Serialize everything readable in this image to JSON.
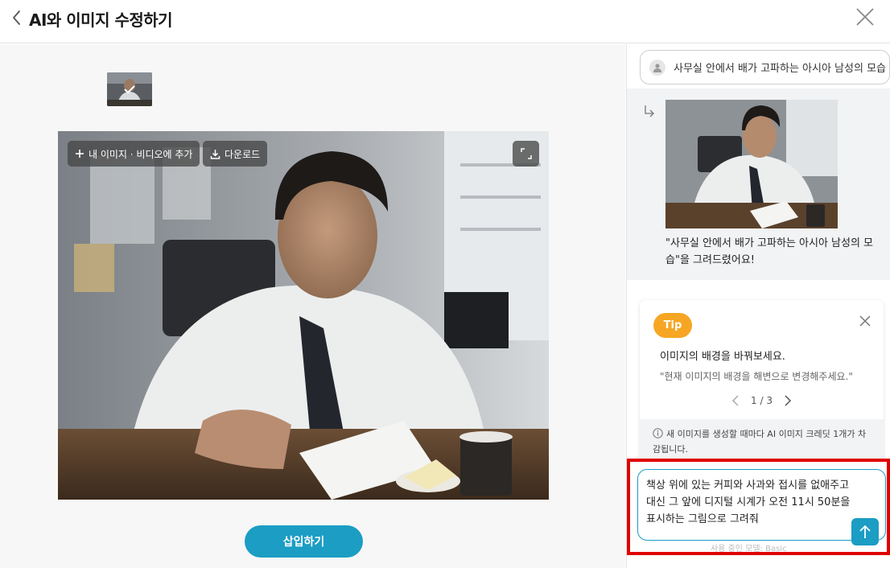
{
  "header": {
    "title": "AI와 이미지 수정하기"
  },
  "image_actions": {
    "add_label": "내 이미지 · 비디오에 추가",
    "download_label": "다운로드"
  },
  "insert_button": "삽입하기",
  "chat": {
    "prompt": "사무실 안에서 배가 고파하는 아시아 남성의 모습",
    "result_caption": "\"사무실 안에서 배가 고파하는 아시아 남성의 모습\"을 그려드렸어요!"
  },
  "tip": {
    "badge": "Tip",
    "title": "이미지의 배경을 바꿔보세요.",
    "example": "\"현재 이미지의 배경을 해변으로 변경해주세요.\"",
    "pager": "1 / 3",
    "notice": "새 이미지를 생성할 때마다 AI 이미지 크레딧 1개가 차감됩니다."
  },
  "input": {
    "value": "책상 위에 있는 커피와 사과와 접시를 없애주고 대신 그 앞에 디지털 시계가 오전 11시 50분을 표시하는 그림으로 그려줘",
    "model_note": "사용 중인 모델: Basic"
  },
  "colors": {
    "accent": "#1b9dc4",
    "tip_badge": "#f6a623",
    "highlight_box": "#e00000"
  },
  "icons": [
    "chevron-left-icon",
    "close-icon",
    "check-icon",
    "plus-icon",
    "download-icon",
    "expand-icon",
    "user-icon",
    "reply-arrow-icon",
    "info-icon",
    "arrow-up-icon"
  ]
}
